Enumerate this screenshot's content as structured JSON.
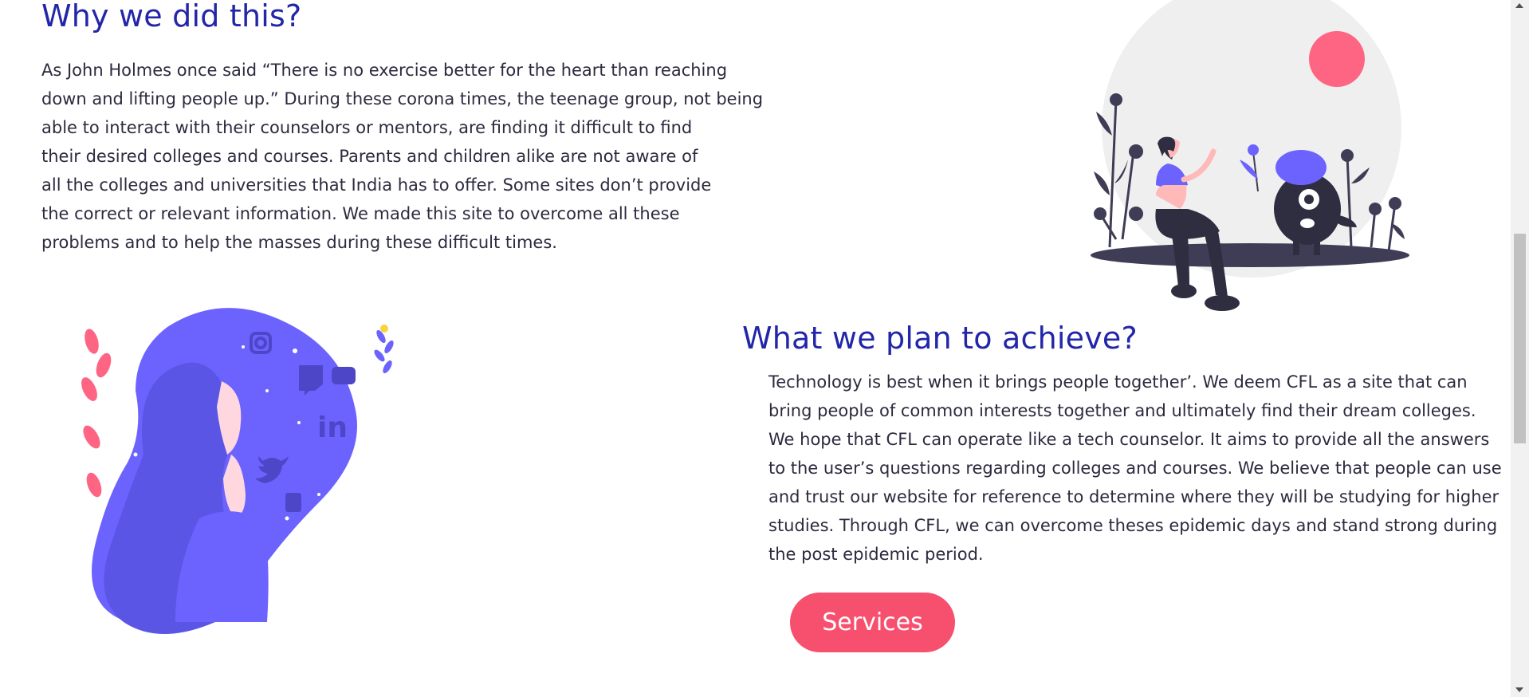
{
  "why": {
    "heading": "Why we did this?",
    "lines": [
      "As John Holmes once said “There is no exercise better for the heart than reaching",
      "down and lifting people up.” During these corona times, the teenage group, not being",
      "able to interact with their counselors or mentors, are finding it difficult to find",
      "their desired colleges and courses. Parents and children alike are not aware of",
      "all the colleges and universities that India has to offer. Some sites don’t provide",
      "the correct or relevant information. We made this site to overcome all these",
      "problems and to help the masses during these difficult times."
    ]
  },
  "plan": {
    "heading": "What we plan to achieve?",
    "lines": [
      "Technology is best when it brings people together’. We deem CFL as a site that can",
      "bring people of common interests together and ultimately find their dream colleges.",
      "We hope that CFL can operate like a tech counselor. It aims to provide all the answers",
      "to the user’s questions regarding colleges and courses. We believe that people can use",
      "and trust our website for reference to determine where they will be studying for higher",
      "studies. Through CFL, we can overcome theses epidemic days and stand strong during",
      "the post epidemic period."
    ],
    "button_label": "Services"
  },
  "colors": {
    "heading": "#2326a8",
    "body_text": "#2d2a3e",
    "accent_pink": "#f7506f",
    "illustration_purple": "#6c63ff",
    "illustration_dark": "#2f2e41"
  },
  "icons": {
    "top_illustration": "person-with-creature-illustration",
    "bottom_illustration": "woman-social-media-illustration"
  }
}
